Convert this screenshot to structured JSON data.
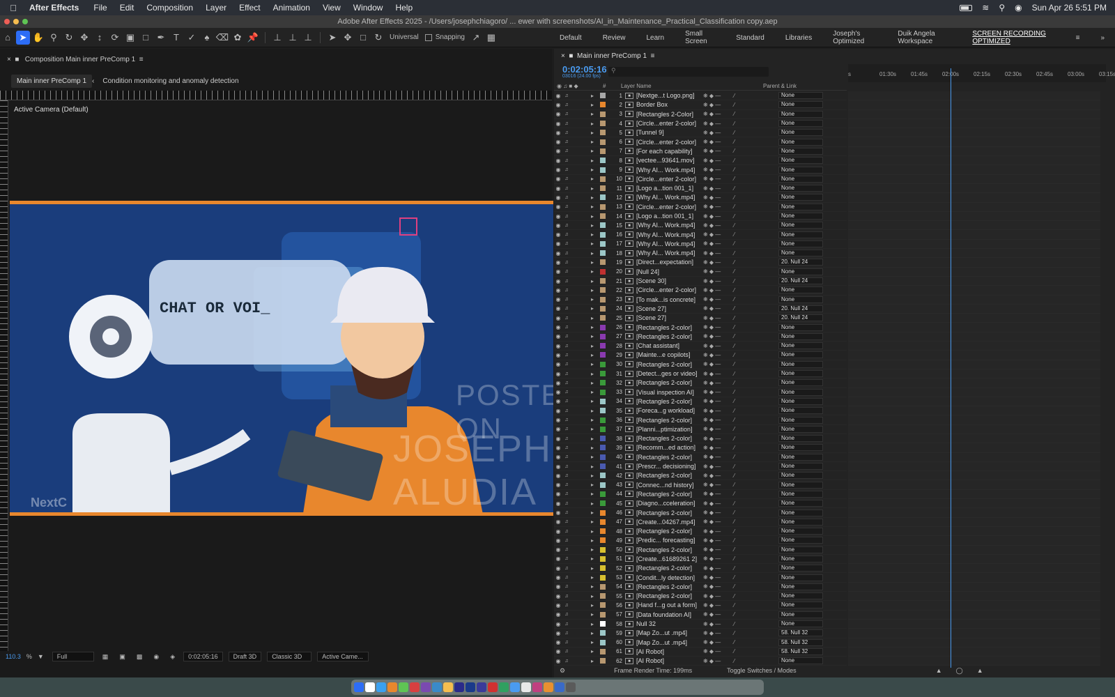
{
  "menubar": {
    "app": "After Effects",
    "items": [
      "File",
      "Edit",
      "Composition",
      "Layer",
      "Effect",
      "Animation",
      "View",
      "Window",
      "Help"
    ],
    "datetime": "Sun Apr 26  5:51 PM"
  },
  "window": {
    "title": "Adobe After Effects 2025 - /Users/josephchiagoro/ ... ewer with screenshots/AI_in_Maintenance_Practical_Classification copy.aep"
  },
  "toolbar": {
    "universal": "Universal",
    "snapping": "Snapping"
  },
  "workspaces": [
    "Default",
    "Review",
    "Learn",
    "Small Screen",
    "Standard",
    "Libraries",
    "Joseph's Optimized",
    "Duik Angela Workspace",
    "SCREEN RECORDING OPTIMIZED"
  ],
  "comp": {
    "panel_title": "Composition Main inner PreComp 1",
    "tab_active": "Main inner PreComp 1",
    "tab_other": "Condition monitoring and anomaly detection",
    "camera_label": "Active Camera (Default)",
    "speech_text": "CHAT OR VOI_",
    "watermark1": "POSTED ON",
    "watermark2": "JOSEPH ALUDIA",
    "brand": "NextC"
  },
  "viewer_footer": {
    "zoom": "110.3",
    "resolution": "Full",
    "time": "0:02:05:16",
    "draft": "Draft 3D",
    "renderer": "Classic 3D",
    "camera": "Active Came..."
  },
  "timeline": {
    "panel_title": "Main inner PreComp 1",
    "timecode": "0:02:05:16",
    "fps": "03016 (24.00 fps)",
    "col_layer": "Layer Name",
    "col_parent": "Parent & Link",
    "ruler_ticks": [
      "s",
      "01:30s",
      "01:45s",
      "02:00s",
      "02:15s",
      "02:30s",
      "02:45s",
      "03:00s",
      "03:15s"
    ],
    "frame_render": "Frame Render Time:  199ms",
    "toggle": "Toggle Switches / Modes"
  },
  "layers": [
    {
      "n": "1",
      "name": "[Nextge...t Logo.png]",
      "parent": "None",
      "color": "#a8a8a8"
    },
    {
      "n": "2",
      "name": "Border Box",
      "parent": "None",
      "color": "#e8872d"
    },
    {
      "n": "3",
      "name": "[Rectangles 2-Color]",
      "parent": "None",
      "color": "#b89870"
    },
    {
      "n": "4",
      "name": "[Circle...enter 2-color]",
      "parent": "None",
      "color": "#b89870"
    },
    {
      "n": "5",
      "name": "[Tunnel 9]",
      "parent": "None",
      "color": "#b89870"
    },
    {
      "n": "6",
      "name": "[Circle...enter 2-color]",
      "parent": "None",
      "color": "#b89870"
    },
    {
      "n": "7",
      "name": "[For each capability]",
      "parent": "None",
      "color": "#b89870"
    },
    {
      "n": "8",
      "name": "[vectee...93641.mov]",
      "parent": "None",
      "color": "#9cc7c7"
    },
    {
      "n": "9",
      "name": "[Why AI... Work.mp4]",
      "parent": "None",
      "color": "#9cc7c7"
    },
    {
      "n": "10",
      "name": "[Circle...enter 2-color]",
      "parent": "None",
      "color": "#b89870"
    },
    {
      "n": "11",
      "name": "[Logo a...tion 001_1]",
      "parent": "None",
      "color": "#b89870"
    },
    {
      "n": "12",
      "name": "[Why AI... Work.mp4]",
      "parent": "None",
      "color": "#9cc7c7"
    },
    {
      "n": "13",
      "name": "[Circle...enter 2-color]",
      "parent": "None",
      "color": "#b89870"
    },
    {
      "n": "14",
      "name": "[Logo a...tion 001_1]",
      "parent": "None",
      "color": "#b89870"
    },
    {
      "n": "15",
      "name": "[Why AI... Work.mp4]",
      "parent": "None",
      "color": "#9cc7c7"
    },
    {
      "n": "16",
      "name": "[Why AI... Work.mp4]",
      "parent": "None",
      "color": "#9cc7c7"
    },
    {
      "n": "17",
      "name": "[Why AI... Work.mp4]",
      "parent": "None",
      "color": "#9cc7c7"
    },
    {
      "n": "18",
      "name": "[Why AI... Work.mp4]",
      "parent": "None",
      "color": "#9cc7c7"
    },
    {
      "n": "19",
      "name": "[Direct...expectation]",
      "parent": "20. Null 24",
      "color": "#b89870"
    },
    {
      "n": "20",
      "name": "[Null 24]",
      "parent": "None",
      "color": "#c03030"
    },
    {
      "n": "21",
      "name": "[Scene 30]",
      "parent": "20. Null 24",
      "color": "#b89870"
    },
    {
      "n": "22",
      "name": "[Circle...enter 2-color]",
      "parent": "None",
      "color": "#b89870"
    },
    {
      "n": "23",
      "name": "[To mak...is concrete]",
      "parent": "None",
      "color": "#b89870"
    },
    {
      "n": "24",
      "name": "[Scene 27]",
      "parent": "20. Null 24",
      "color": "#b89870"
    },
    {
      "n": "25",
      "name": "[Scene 27]",
      "parent": "20. Null 24",
      "color": "#b89870"
    },
    {
      "n": "26",
      "name": "[Rectangles 2-color]",
      "parent": "None",
      "color": "#8a3ab0"
    },
    {
      "n": "27",
      "name": "[Rectangles 2-color]",
      "parent": "None",
      "color": "#8a3ab0"
    },
    {
      "n": "28",
      "name": "[Chat assistant]",
      "parent": "None",
      "color": "#8a3ab0"
    },
    {
      "n": "29",
      "name": "[Mainte...e copilots]",
      "parent": "None",
      "color": "#8a3ab0"
    },
    {
      "n": "30",
      "name": "[Rectangles 2-color]",
      "parent": "None",
      "color": "#3a9a3a"
    },
    {
      "n": "31",
      "name": "[Detect...ges or video]",
      "parent": "None",
      "color": "#3a9a3a"
    },
    {
      "n": "32",
      "name": "[Rectangles 2-color]",
      "parent": "None",
      "color": "#3a9a3a"
    },
    {
      "n": "33",
      "name": "[Visual inspection AI]",
      "parent": "None",
      "color": "#3a9a3a"
    },
    {
      "n": "34",
      "name": "[Rectangles 2-color]",
      "parent": "None",
      "color": "#9cc7c7"
    },
    {
      "n": "35",
      "name": "[Foreca...g workload]",
      "parent": "None",
      "color": "#9cc7c7"
    },
    {
      "n": "36",
      "name": "[Rectangles 2-color]",
      "parent": "None",
      "color": "#3a9a3a"
    },
    {
      "n": "37",
      "name": "[Planni...ptimization]",
      "parent": "None",
      "color": "#3a9a3a"
    },
    {
      "n": "38",
      "name": "[Rectangles 2-color]",
      "parent": "None",
      "color": "#4a5ab0"
    },
    {
      "n": "39",
      "name": "[Recomm...ed action]",
      "parent": "None",
      "color": "#4a5ab0"
    },
    {
      "n": "40",
      "name": "[Rectangles 2-color]",
      "parent": "None",
      "color": "#4a5ab0"
    },
    {
      "n": "41",
      "name": "[Prescr... decisioning]",
      "parent": "None",
      "color": "#4a5ab0"
    },
    {
      "n": "42",
      "name": "[Rectangles 2-color]",
      "parent": "None",
      "color": "#9cc7c7"
    },
    {
      "n": "43",
      "name": "[Connec...nd history]",
      "parent": "None",
      "color": "#9cc7c7"
    },
    {
      "n": "44",
      "name": "[Rectangles 2-color]",
      "parent": "None",
      "color": "#3a9a3a"
    },
    {
      "n": "45",
      "name": "[Diagno...cceleration]",
      "parent": "None",
      "color": "#3a9a3a"
    },
    {
      "n": "46",
      "name": "[Rectangles 2-color]",
      "parent": "None",
      "color": "#e8872d"
    },
    {
      "n": "47",
      "name": "[Create...04267.mp4]",
      "parent": "None",
      "color": "#e8872d"
    },
    {
      "n": "48",
      "name": "[Rectangles 2-color]",
      "parent": "None",
      "color": "#e8872d"
    },
    {
      "n": "49",
      "name": "[Predic... forecasting]",
      "parent": "None",
      "color": "#e8872d"
    },
    {
      "n": "50",
      "name": "[Rectangles 2-color]",
      "parent": "None",
      "color": "#d8c030"
    },
    {
      "n": "51",
      "name": "[Create...61689261 2]",
      "parent": "None",
      "color": "#d8c030"
    },
    {
      "n": "52",
      "name": "[Rectangles 2-color]",
      "parent": "None",
      "color": "#d8c030"
    },
    {
      "n": "53",
      "name": "[Condit...ly detection]",
      "parent": "None",
      "color": "#d8c030"
    },
    {
      "n": "54",
      "name": "[Rectangles 2-color]",
      "parent": "None",
      "color": "#b89870"
    },
    {
      "n": "55",
      "name": "[Rectangles 2-color]",
      "parent": "None",
      "color": "#b89870"
    },
    {
      "n": "56",
      "name": "[Hand f...g out a form]",
      "parent": "None",
      "color": "#b89870"
    },
    {
      "n": "57",
      "name": "[Data foundation AI]",
      "parent": "None",
      "color": "#b89870"
    },
    {
      "n": "58",
      "name": "Null 32",
      "parent": "None",
      "color": "#ffffff"
    },
    {
      "n": "59",
      "name": "[Map Zo...ut .mp4]",
      "parent": "58. Null 32",
      "color": "#9cc7c7"
    },
    {
      "n": "60",
      "name": "[Map Zo...ut .mp4]",
      "parent": "58. Null 32",
      "color": "#9cc7c7"
    },
    {
      "n": "61",
      "name": "[AI Robot]",
      "parent": "58. Null 32",
      "color": "#b89870"
    },
    {
      "n": "62",
      "name": "[AI Robot]",
      "parent": "None",
      "color": "#b89870"
    }
  ]
}
